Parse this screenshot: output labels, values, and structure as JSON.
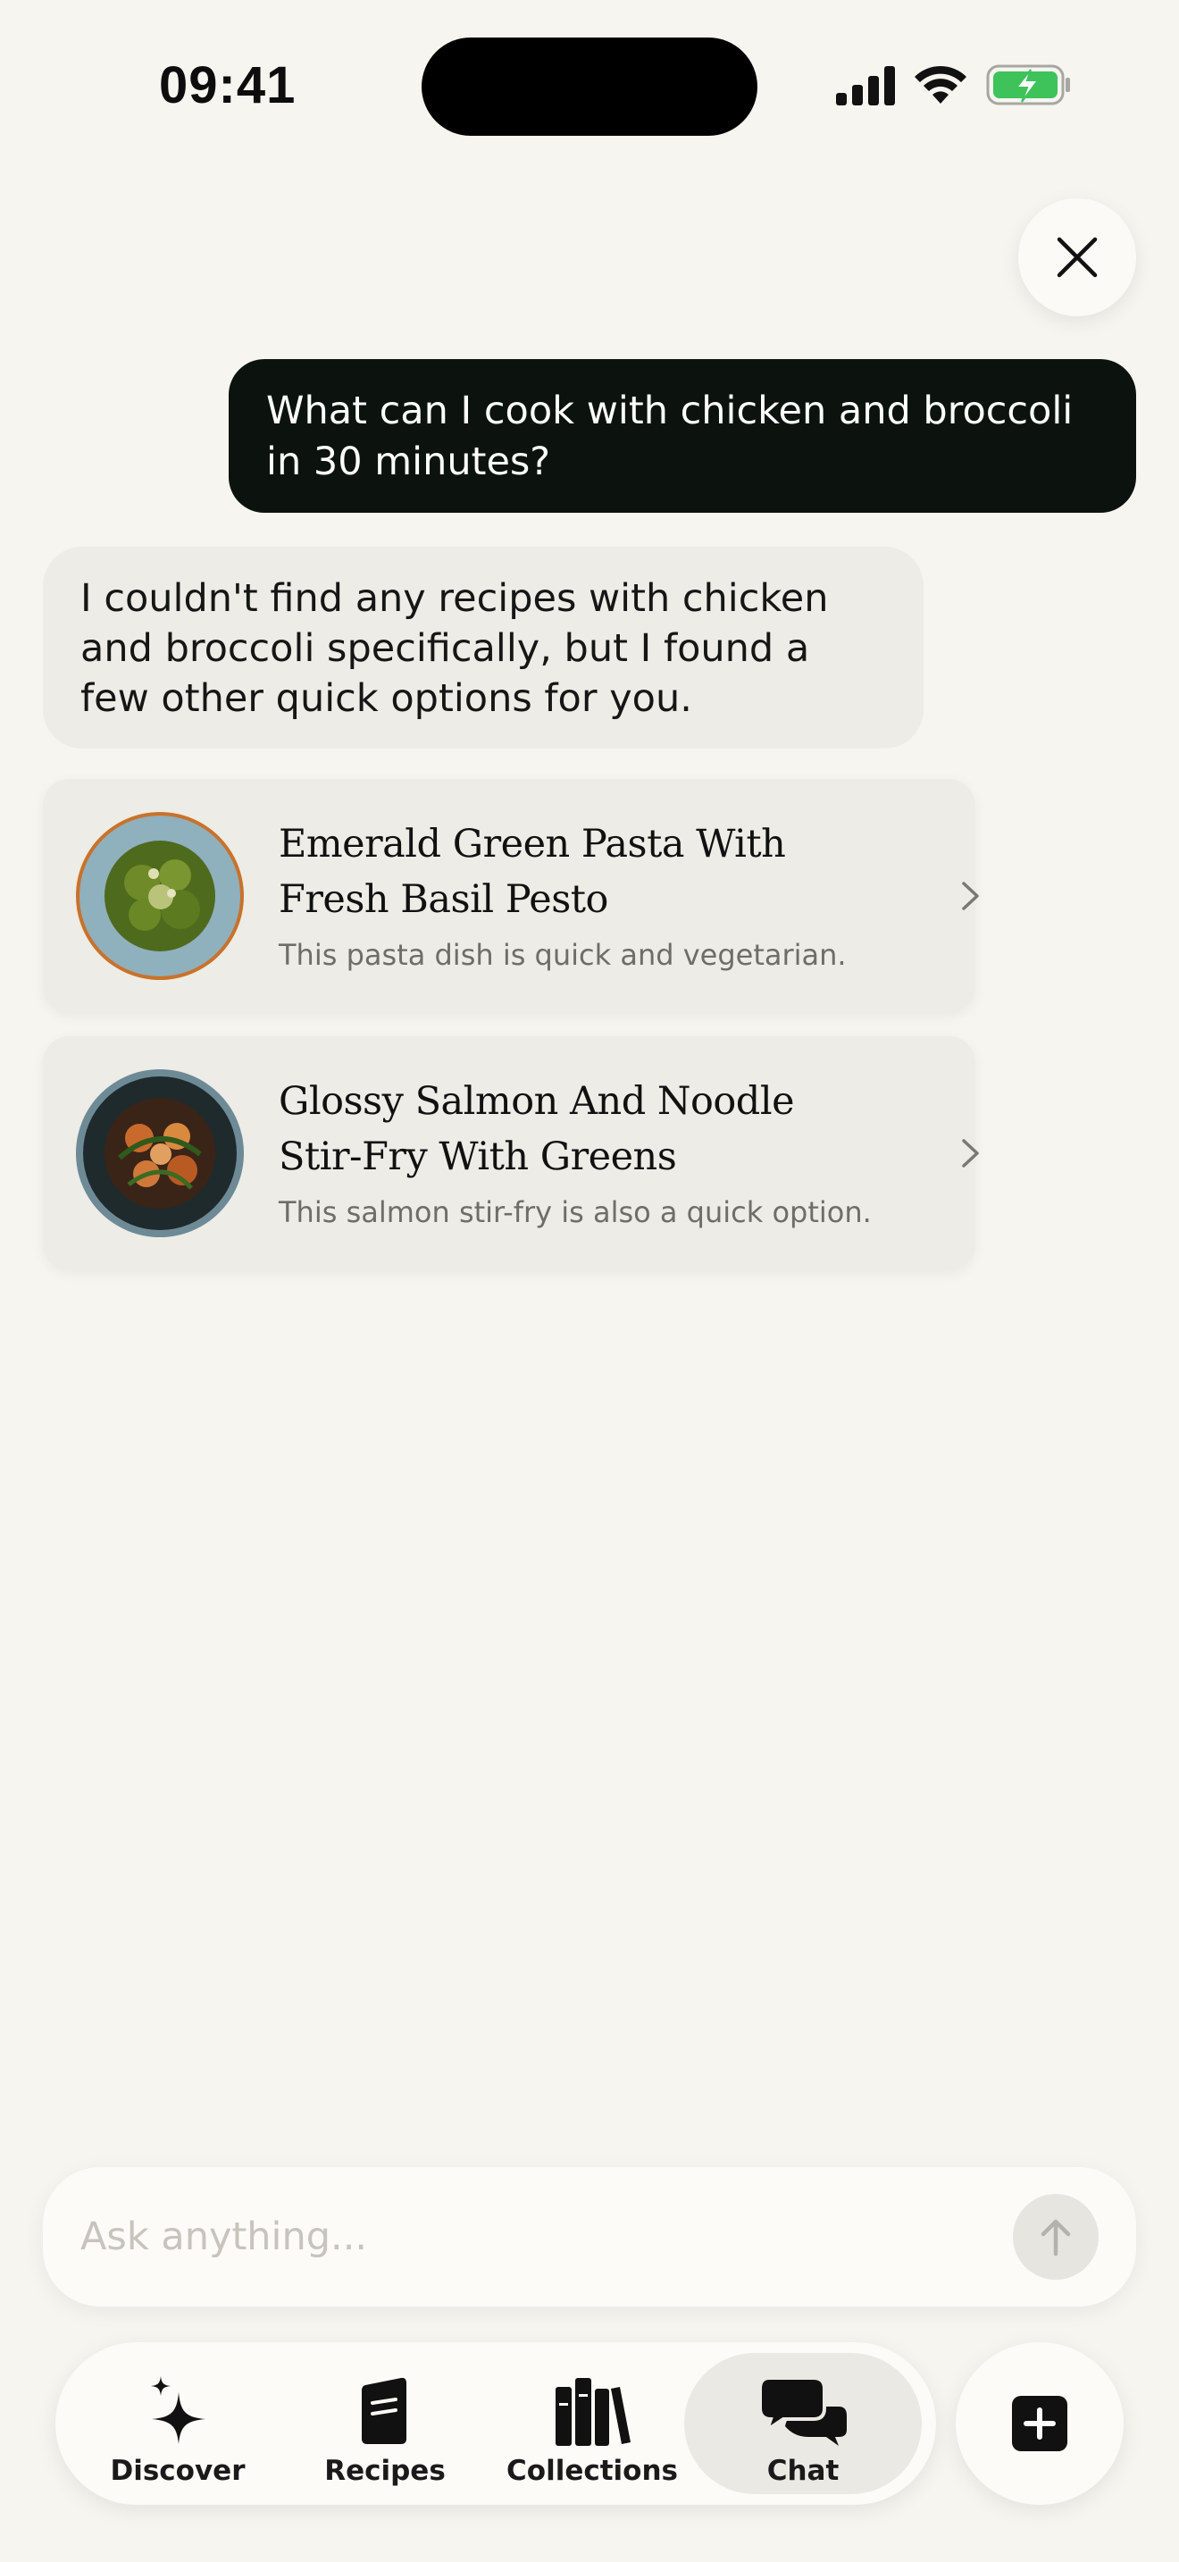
{
  "status_bar": {
    "time": "09:41"
  },
  "colors": {
    "background": "#f6f5f0",
    "user_bubble": "#0c130f",
    "assistant_bubble": "#edece6",
    "battery_green": "#3ec25a"
  },
  "chat": {
    "user_message": "What can I cook with chicken and broccoli in 30 minutes?",
    "assistant_message": "I couldn't find any recipes with chicken and broccoli specifically, but I found a few other quick options for you."
  },
  "recipes": [
    {
      "title": "Emerald Green Pasta With Fresh Basil Pesto",
      "description": "This pasta dish is quick and vegetarian."
    },
    {
      "title": "Glossy Salmon And Noodle Stir-Fry With Greens",
      "description": "This salmon stir-fry is also a quick option."
    }
  ],
  "input": {
    "placeholder": "Ask anything..."
  },
  "tabs": [
    {
      "label": "Discover",
      "icon": "sparkles-icon"
    },
    {
      "label": "Recipes",
      "icon": "book-icon"
    },
    {
      "label": "Collections",
      "icon": "books-icon"
    },
    {
      "label": "Chat",
      "icon": "chat-bubbles-icon",
      "active": true
    }
  ],
  "fab_icon": "plus-square-icon"
}
